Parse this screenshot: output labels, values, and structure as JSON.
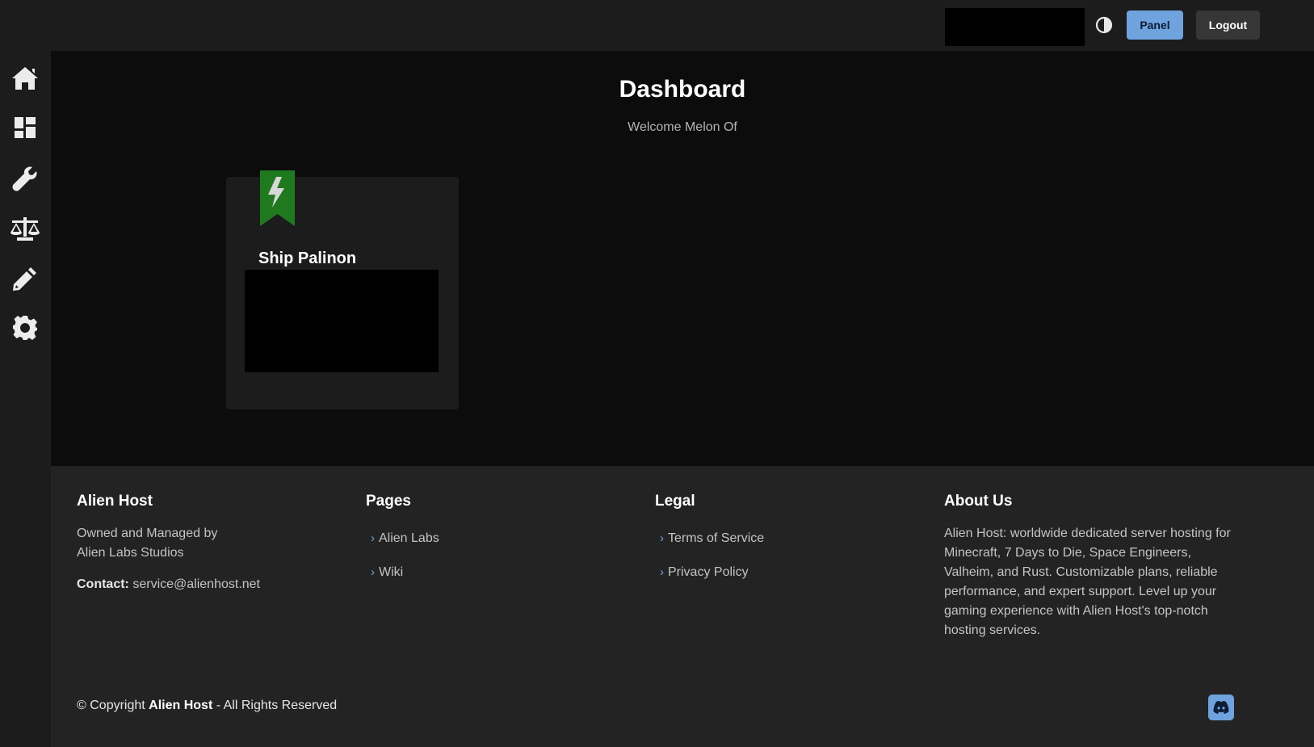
{
  "header": {
    "panel_label": "Panel",
    "logout_label": "Logout",
    "theme_toggle_icon": "half-circle-contrast-icon"
  },
  "sidebar": {
    "items": [
      {
        "icon": "home-icon"
      },
      {
        "icon": "dashboard-grid-icon"
      },
      {
        "icon": "wrench-icon"
      },
      {
        "icon": "scale-balance-icon"
      },
      {
        "icon": "pencil-icon"
      },
      {
        "icon": "gear-icon"
      }
    ]
  },
  "main": {
    "title": "Dashboard",
    "welcome": "Welcome Melon Of",
    "servers": [
      {
        "name": "Ship Palinon",
        "badge_icon": "lightning-bookmark-icon",
        "badge_color": "#1f7a1f"
      }
    ]
  },
  "footer": {
    "brand": {
      "heading": "Alien Host",
      "line1": "Owned and Managed by",
      "line2": "Alien Labs Studios",
      "contact_label": "Contact:",
      "contact_value": "service@alienhost.net"
    },
    "pages": {
      "heading": "Pages",
      "links": [
        "Alien Labs",
        "Wiki"
      ]
    },
    "legal": {
      "heading": "Legal",
      "links": [
        "Terms of Service",
        "Privacy Policy"
      ]
    },
    "about": {
      "heading": "About Us",
      "text": "Alien Host: worldwide dedicated server hosting for Minecraft, 7 Days to Die, Space Engineers, Valheim, and Rust. Customizable plans, reliable performance, and expert support. Level up your gaming experience with Alien Host's top-notch hosting services."
    },
    "copyright": {
      "prefix": "© Copyright ",
      "brand": "Alien Host",
      "suffix": " - All Rights Reserved"
    },
    "social_icon": "discord-icon"
  },
  "colors": {
    "accent": "#6ea3de",
    "badge_green": "#1f7a1f",
    "background": "#0c0c0c",
    "panel": "#1c1c1c",
    "footer": "#232323"
  }
}
